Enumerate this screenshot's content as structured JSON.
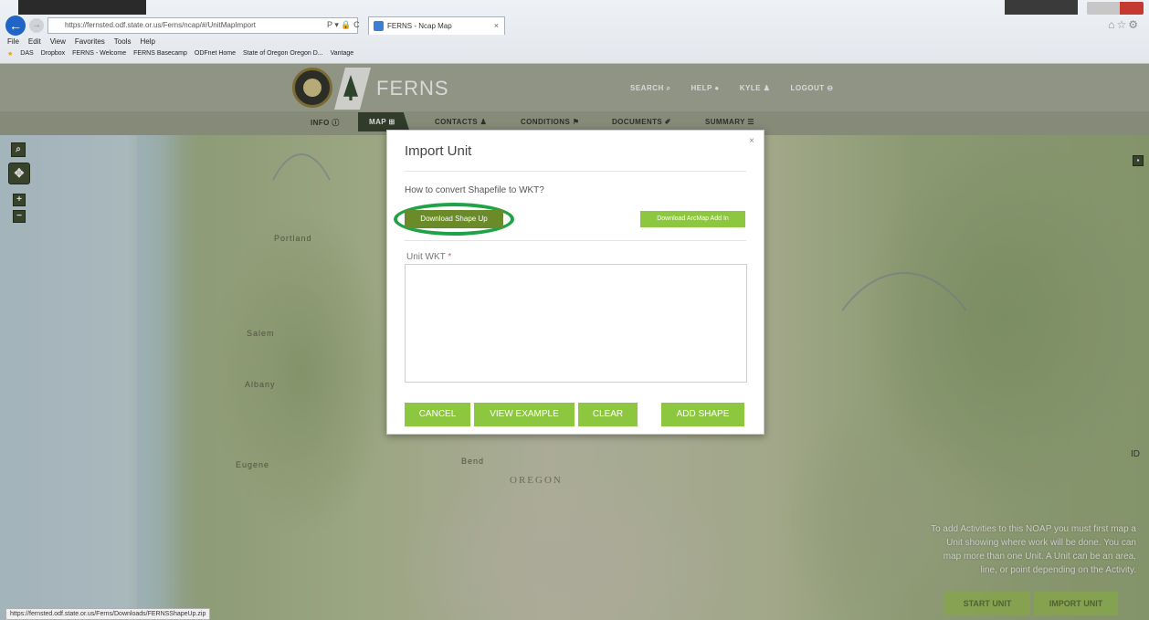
{
  "browser": {
    "address": "https://fernsted.odf.state.or.us/Ferns/ncap/#/UnitMapImport",
    "addr_tools": "P ▾ 🔒 C",
    "tab_title": "FERNS - Ncap Map",
    "tab_close": "×",
    "menu": [
      "File",
      "Edit",
      "View",
      "Favorites",
      "Tools",
      "Help"
    ],
    "favorites": [
      "DAS",
      "Dropbox",
      "FERNS - Welcome",
      "FERNS Basecamp",
      "ODFnet Home",
      "State of Oregon Oregon D...",
      "Vantage"
    ],
    "status_url": "https://fernsted.odf.state.or.us/Ferns/Downloads/FERNSShapeUp.zip"
  },
  "header": {
    "brand": "FERNS",
    "nav": [
      "SEARCH ⌕",
      "HELP ●",
      "KYLE ♟",
      "LOGOUT ⊖"
    ]
  },
  "subnav": {
    "items": [
      "INFO ⓘ",
      "MAP ⊞",
      "CONTACTS ♟",
      "CONDITIONS ⚑",
      "DOCUMENTS ✐",
      "SUMMARY ☰"
    ],
    "active_index": 1
  },
  "map": {
    "labels": [
      "Portland",
      "Salem",
      "Eugene",
      "Albany",
      "Bend"
    ],
    "state_label": "OREGON",
    "edge_label": "ID",
    "info_text": "To add Activities to this NOAP you must first map a Unit showing where work will be done. You can map more than one Unit. A Unit can be an area, line, or point depending on the Activity.",
    "start_unit": "START UNIT",
    "import_unit": "IMPORT UNIT"
  },
  "modal": {
    "title": "Import Unit",
    "close": "×",
    "how_to": "How to convert Shapefile to WKT?",
    "download_shape_up": "Download Shape Up",
    "download_arcmap": "Download ArcMap Add In",
    "wkt_label": "Unit WKT",
    "wkt_required": "*",
    "wkt_value": "",
    "cancel": "CANCEL",
    "view_example": "VIEW EXAMPLE",
    "clear": "CLEAR",
    "add_shape": "ADD SHAPE"
  },
  "colors": {
    "accent_green": "#8dc63f",
    "dark_green": "#6b8a2a",
    "highlight_ring": "#1fa346",
    "header_bg": "#a8ad9a"
  }
}
